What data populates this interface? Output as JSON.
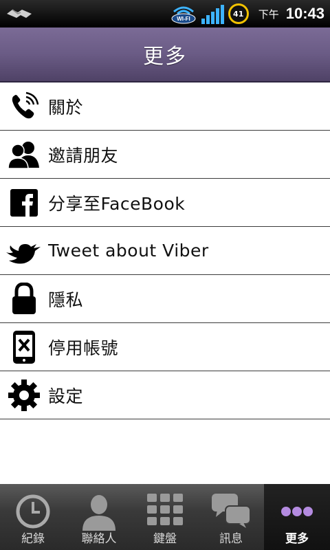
{
  "status_bar": {
    "wifi_label": "WI-FI",
    "battery": "41",
    "ampm": "下午",
    "time": "10:43"
  },
  "header": {
    "title": "更多"
  },
  "menu": {
    "items": [
      {
        "label": "關於",
        "icon": "phone-icon"
      },
      {
        "label": "邀請朋友",
        "icon": "friends-icon"
      },
      {
        "label": "分享至FaceBook",
        "icon": "facebook-icon"
      },
      {
        "label": "Tweet about Viber",
        "icon": "twitter-bird-icon"
      },
      {
        "label": "隱私",
        "icon": "lock-icon"
      },
      {
        "label": "停用帳號",
        "icon": "deactivate-phone-icon"
      },
      {
        "label": "設定",
        "icon": "gear-icon"
      }
    ]
  },
  "tabs": {
    "items": [
      {
        "label": "紀錄",
        "icon": "clock-icon"
      },
      {
        "label": "聯絡人",
        "icon": "contact-icon"
      },
      {
        "label": "鍵盤",
        "icon": "keypad-icon"
      },
      {
        "label": "訊息",
        "icon": "messages-icon"
      },
      {
        "label": "更多",
        "icon": "more-dots-icon",
        "active": true
      }
    ]
  },
  "colors": {
    "header": "#6a5b85",
    "accent_dots": "#b48be0"
  }
}
